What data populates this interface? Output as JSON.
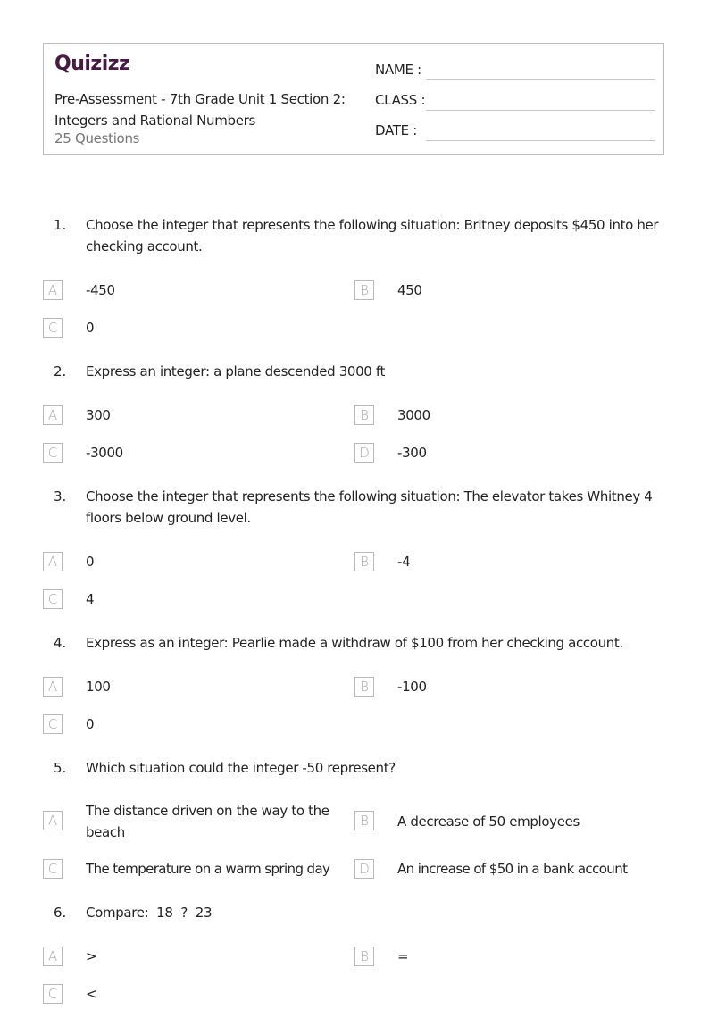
{
  "header": {
    "logo": "Quizizz",
    "title": "Pre-Assessment - 7th Grade Unit 1 Section 2: Integers and Rational Numbers",
    "question_count": "25 Questions",
    "fields": [
      {
        "label": "NAME :",
        "value": ""
      },
      {
        "label": "CLASS :",
        "value": ""
      },
      {
        "label": "DATE  :",
        "value": ""
      }
    ]
  },
  "colors": {
    "brand": "#461a42",
    "border": "#bdbdbd",
    "option_letter": "#a8a8a8"
  },
  "questions": [
    {
      "number": "1.",
      "text": "Choose the integer that represents the following situation: Britney deposits $450 into her checking account.",
      "options": [
        {
          "letter": "A",
          "text": "-450"
        },
        {
          "letter": "B",
          "text": "450"
        },
        {
          "letter": "C",
          "text": "0"
        }
      ]
    },
    {
      "number": "2.",
      "text": "Express an integer: a plane descended 3000 ft",
      "options": [
        {
          "letter": "A",
          "text": "300"
        },
        {
          "letter": "B",
          "text": "3000"
        },
        {
          "letter": "C",
          "text": "-3000"
        },
        {
          "letter": "D",
          "text": "-300"
        }
      ]
    },
    {
      "number": "3.",
      "text": "Choose the integer that represents the following situation: The elevator takes Whitney 4 floors below ground level.",
      "options": [
        {
          "letter": "A",
          "text": "0"
        },
        {
          "letter": "B",
          "text": "-4"
        },
        {
          "letter": "C",
          "text": "4"
        }
      ]
    },
    {
      "number": "4.",
      "text": "Express as an integer: Pearlie made a withdraw of $100 from her checking account.",
      "options": [
        {
          "letter": "A",
          "text": "100"
        },
        {
          "letter": "B",
          "text": "-100"
        },
        {
          "letter": "C",
          "text": "0"
        }
      ]
    },
    {
      "number": "5.",
      "text": "Which situation could the integer -50 represent?",
      "options": [
        {
          "letter": "A",
          "text": "The distance driven on the way to the beach"
        },
        {
          "letter": "B",
          "text": "A decrease of 50 employees"
        },
        {
          "letter": "C",
          "text": "The temperature on a warm spring day"
        },
        {
          "letter": "D",
          "text": "An increase of $50 in a bank account"
        }
      ]
    },
    {
      "number": "6.",
      "text": "Compare:  18  ?  23",
      "options": [
        {
          "letter": "A",
          "text": ">"
        },
        {
          "letter": "B",
          "text": "="
        },
        {
          "letter": "C",
          "text": "<"
        }
      ]
    }
  ]
}
